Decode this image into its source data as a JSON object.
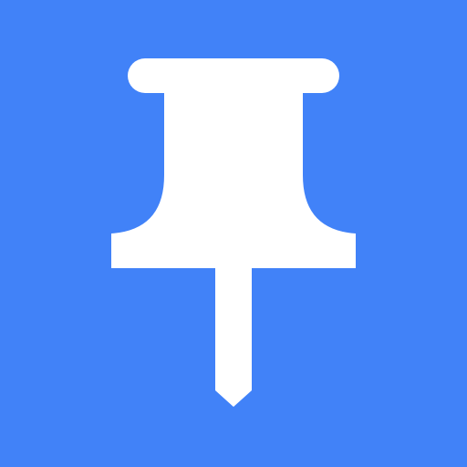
{
  "icon": {
    "name": "pushpin-icon",
    "background_color": "#4182f8",
    "glyph_color": "#ffffff"
  }
}
